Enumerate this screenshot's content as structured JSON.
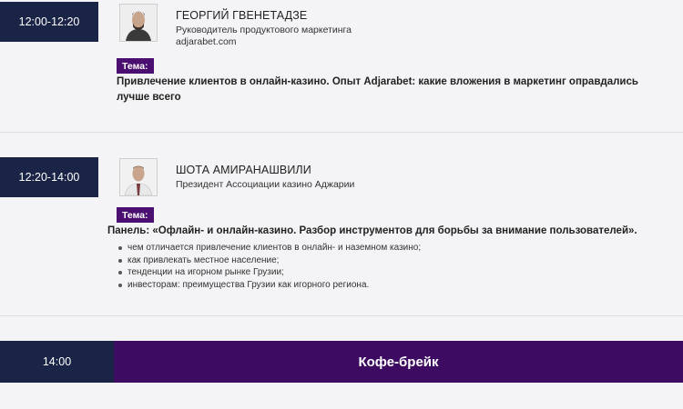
{
  "sessions": [
    {
      "time": "12:00-12:20",
      "speaker_name": "ГЕОРГИЙ ГВЕНЕТАДЗЕ",
      "speaker_role": "Руководитель продуктового маркетинга",
      "speaker_company": "adjarabet.com",
      "tema_label": "Тема:",
      "topic_line1": "Привлечение клиентов в онлайн-казино. Опыт Adjarabet: какие вложения в маркетинг оправдались",
      "topic_line2": "лучше всего"
    },
    {
      "time": "12:20-14:00",
      "speaker_name": "ШОТА АМИРАНАШВИЛИ",
      "speaker_role": "Президент Ассоциации казино Аджарии",
      "tema_label": "Тема:",
      "topic_line1": "Панель: «Офлайн- и онлайн-казино. Разбор инструментов для борьбы за внимание пользователей».",
      "bullets": [
        "чем отличается привлечение клиентов в онлайн- и наземном казино;",
        "как привлекать местное население;",
        "тенденции на игорном рынке Грузии;",
        "инвесторам: преимущества Грузии как игорного региона."
      ]
    }
  ],
  "break": {
    "time": "14:00",
    "label": "Кофе-брейк"
  },
  "colors": {
    "time_badge": "#1a2447",
    "tema_badge": "#4a0f70",
    "break_bar": "#3d0c62",
    "background": "#f4f3f5"
  },
  "icons": {
    "speaker_photo": "avatar-photo"
  }
}
